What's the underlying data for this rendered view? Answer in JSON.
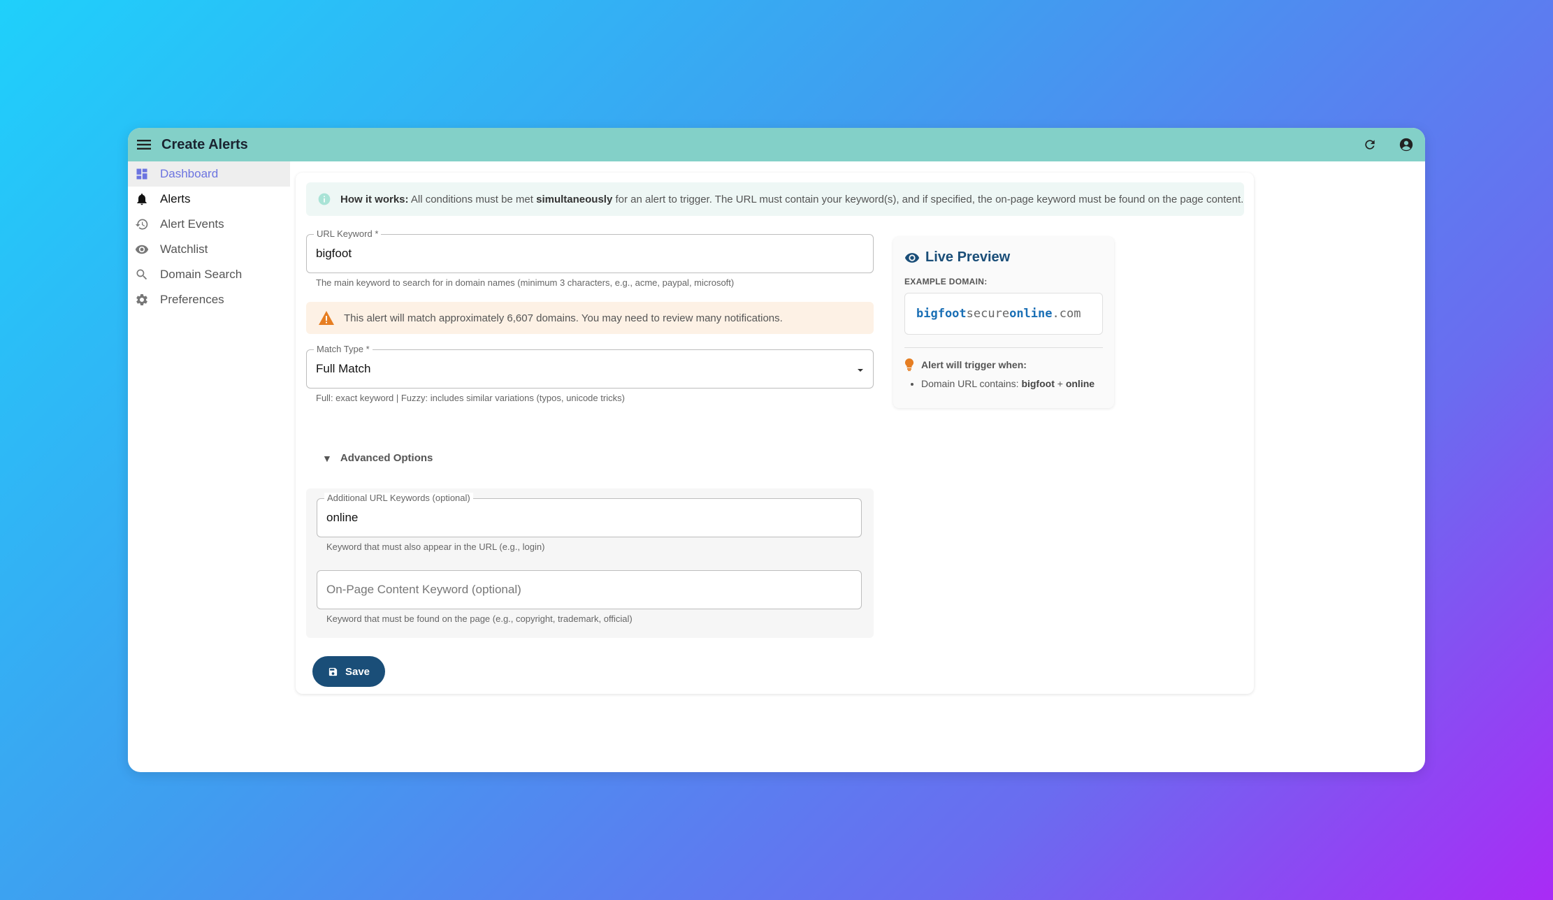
{
  "appbar": {
    "title": "Create Alerts",
    "menu_icon": "menu-icon",
    "refresh_icon": "refresh-icon",
    "account_icon": "account-icon"
  },
  "sidebar": {
    "items": [
      {
        "label": "Dashboard",
        "icon": "dashboard-icon"
      },
      {
        "label": "Alerts",
        "icon": "bell-icon"
      },
      {
        "label": "Alert Events",
        "icon": "history-icon"
      },
      {
        "label": "Watchlist",
        "icon": "eye-icon"
      },
      {
        "label": "Domain Search",
        "icon": "search-icon"
      },
      {
        "label": "Preferences",
        "icon": "gear-icon"
      }
    ]
  },
  "info": {
    "lead": "How it works:",
    "text1": " All conditions must be met ",
    "emph": "simultaneously",
    "text2": " for an alert to trigger. The URL must contain your keyword(s), and if specified, the on-page keyword must be found on the page content."
  },
  "form": {
    "url_keyword": {
      "label": "URL Keyword *",
      "value": "bigfoot",
      "helper": "The main keyword to search for in domain names (minimum 3 characters, e.g., acme, paypal, microsoft)"
    },
    "warning": "This alert will match approximately 6,607 domains. You may need to review many notifications.",
    "match_type": {
      "label": "Match Type *",
      "value": "Full Match",
      "helper": "Full: exact keyword | Fuzzy: includes similar variations (typos, unicode tricks)"
    },
    "advanced_label": "Advanced Options",
    "additional_keywords": {
      "label": "Additional URL Keywords (optional)",
      "value": "online",
      "helper": "Keyword that must also appear in the URL (e.g., login)"
    },
    "onpage_keyword": {
      "placeholder": "On-Page Content Keyword (optional)",
      "helper": "Keyword that must be found on the page (e.g., copyright, trademark, official)"
    },
    "save_label": "Save"
  },
  "preview": {
    "title": "Live Preview",
    "example_label": "EXAMPLE DOMAIN:",
    "domain_parts": {
      "kw1": "bigfoot",
      "mid": "secure",
      "kw2": "online",
      "tld": ".com"
    },
    "trigger_label": "Alert will trigger when:",
    "condition_prefix": "Domain URL contains: ",
    "condition_kw1": "bigfoot",
    "condition_plus": " + ",
    "condition_kw2": "online"
  },
  "colors": {
    "appbar": "#83d0c8",
    "accent": "#1a4e78",
    "nav_active": "#6c74e0",
    "warning": "#e67e22"
  }
}
